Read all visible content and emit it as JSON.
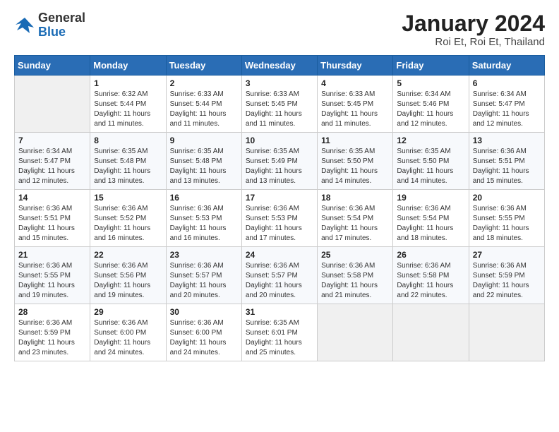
{
  "logo": {
    "general": "General",
    "blue": "Blue"
  },
  "header": {
    "title": "January 2024",
    "subtitle": "Roi Et, Roi Et, Thailand"
  },
  "weekdays": [
    "Sunday",
    "Monday",
    "Tuesday",
    "Wednesday",
    "Thursday",
    "Friday",
    "Saturday"
  ],
  "weeks": [
    [
      {
        "num": "",
        "empty": true
      },
      {
        "num": "1",
        "sunrise": "Sunrise: 6:32 AM",
        "sunset": "Sunset: 5:44 PM",
        "daylight": "Daylight: 11 hours and 11 minutes."
      },
      {
        "num": "2",
        "sunrise": "Sunrise: 6:33 AM",
        "sunset": "Sunset: 5:44 PM",
        "daylight": "Daylight: 11 hours and 11 minutes."
      },
      {
        "num": "3",
        "sunrise": "Sunrise: 6:33 AM",
        "sunset": "Sunset: 5:45 PM",
        "daylight": "Daylight: 11 hours and 11 minutes."
      },
      {
        "num": "4",
        "sunrise": "Sunrise: 6:33 AM",
        "sunset": "Sunset: 5:45 PM",
        "daylight": "Daylight: 11 hours and 11 minutes."
      },
      {
        "num": "5",
        "sunrise": "Sunrise: 6:34 AM",
        "sunset": "Sunset: 5:46 PM",
        "daylight": "Daylight: 11 hours and 12 minutes."
      },
      {
        "num": "6",
        "sunrise": "Sunrise: 6:34 AM",
        "sunset": "Sunset: 5:47 PM",
        "daylight": "Daylight: 11 hours and 12 minutes."
      }
    ],
    [
      {
        "num": "7",
        "sunrise": "Sunrise: 6:34 AM",
        "sunset": "Sunset: 5:47 PM",
        "daylight": "Daylight: 11 hours and 12 minutes."
      },
      {
        "num": "8",
        "sunrise": "Sunrise: 6:35 AM",
        "sunset": "Sunset: 5:48 PM",
        "daylight": "Daylight: 11 hours and 13 minutes."
      },
      {
        "num": "9",
        "sunrise": "Sunrise: 6:35 AM",
        "sunset": "Sunset: 5:48 PM",
        "daylight": "Daylight: 11 hours and 13 minutes."
      },
      {
        "num": "10",
        "sunrise": "Sunrise: 6:35 AM",
        "sunset": "Sunset: 5:49 PM",
        "daylight": "Daylight: 11 hours and 13 minutes."
      },
      {
        "num": "11",
        "sunrise": "Sunrise: 6:35 AM",
        "sunset": "Sunset: 5:50 PM",
        "daylight": "Daylight: 11 hours and 14 minutes."
      },
      {
        "num": "12",
        "sunrise": "Sunrise: 6:35 AM",
        "sunset": "Sunset: 5:50 PM",
        "daylight": "Daylight: 11 hours and 14 minutes."
      },
      {
        "num": "13",
        "sunrise": "Sunrise: 6:36 AM",
        "sunset": "Sunset: 5:51 PM",
        "daylight": "Daylight: 11 hours and 15 minutes."
      }
    ],
    [
      {
        "num": "14",
        "sunrise": "Sunrise: 6:36 AM",
        "sunset": "Sunset: 5:51 PM",
        "daylight": "Daylight: 11 hours and 15 minutes."
      },
      {
        "num": "15",
        "sunrise": "Sunrise: 6:36 AM",
        "sunset": "Sunset: 5:52 PM",
        "daylight": "Daylight: 11 hours and 16 minutes."
      },
      {
        "num": "16",
        "sunrise": "Sunrise: 6:36 AM",
        "sunset": "Sunset: 5:53 PM",
        "daylight": "Daylight: 11 hours and 16 minutes."
      },
      {
        "num": "17",
        "sunrise": "Sunrise: 6:36 AM",
        "sunset": "Sunset: 5:53 PM",
        "daylight": "Daylight: 11 hours and 17 minutes."
      },
      {
        "num": "18",
        "sunrise": "Sunrise: 6:36 AM",
        "sunset": "Sunset: 5:54 PM",
        "daylight": "Daylight: 11 hours and 17 minutes."
      },
      {
        "num": "19",
        "sunrise": "Sunrise: 6:36 AM",
        "sunset": "Sunset: 5:54 PM",
        "daylight": "Daylight: 11 hours and 18 minutes."
      },
      {
        "num": "20",
        "sunrise": "Sunrise: 6:36 AM",
        "sunset": "Sunset: 5:55 PM",
        "daylight": "Daylight: 11 hours and 18 minutes."
      }
    ],
    [
      {
        "num": "21",
        "sunrise": "Sunrise: 6:36 AM",
        "sunset": "Sunset: 5:55 PM",
        "daylight": "Daylight: 11 hours and 19 minutes."
      },
      {
        "num": "22",
        "sunrise": "Sunrise: 6:36 AM",
        "sunset": "Sunset: 5:56 PM",
        "daylight": "Daylight: 11 hours and 19 minutes."
      },
      {
        "num": "23",
        "sunrise": "Sunrise: 6:36 AM",
        "sunset": "Sunset: 5:57 PM",
        "daylight": "Daylight: 11 hours and 20 minutes."
      },
      {
        "num": "24",
        "sunrise": "Sunrise: 6:36 AM",
        "sunset": "Sunset: 5:57 PM",
        "daylight": "Daylight: 11 hours and 20 minutes."
      },
      {
        "num": "25",
        "sunrise": "Sunrise: 6:36 AM",
        "sunset": "Sunset: 5:58 PM",
        "daylight": "Daylight: 11 hours and 21 minutes."
      },
      {
        "num": "26",
        "sunrise": "Sunrise: 6:36 AM",
        "sunset": "Sunset: 5:58 PM",
        "daylight": "Daylight: 11 hours and 22 minutes."
      },
      {
        "num": "27",
        "sunrise": "Sunrise: 6:36 AM",
        "sunset": "Sunset: 5:59 PM",
        "daylight": "Daylight: 11 hours and 22 minutes."
      }
    ],
    [
      {
        "num": "28",
        "sunrise": "Sunrise: 6:36 AM",
        "sunset": "Sunset: 5:59 PM",
        "daylight": "Daylight: 11 hours and 23 minutes."
      },
      {
        "num": "29",
        "sunrise": "Sunrise: 6:36 AM",
        "sunset": "Sunset: 6:00 PM",
        "daylight": "Daylight: 11 hours and 24 minutes."
      },
      {
        "num": "30",
        "sunrise": "Sunrise: 6:36 AM",
        "sunset": "Sunset: 6:00 PM",
        "daylight": "Daylight: 11 hours and 24 minutes."
      },
      {
        "num": "31",
        "sunrise": "Sunrise: 6:35 AM",
        "sunset": "Sunset: 6:01 PM",
        "daylight": "Daylight: 11 hours and 25 minutes."
      },
      {
        "num": "",
        "empty": true
      },
      {
        "num": "",
        "empty": true
      },
      {
        "num": "",
        "empty": true
      }
    ]
  ]
}
